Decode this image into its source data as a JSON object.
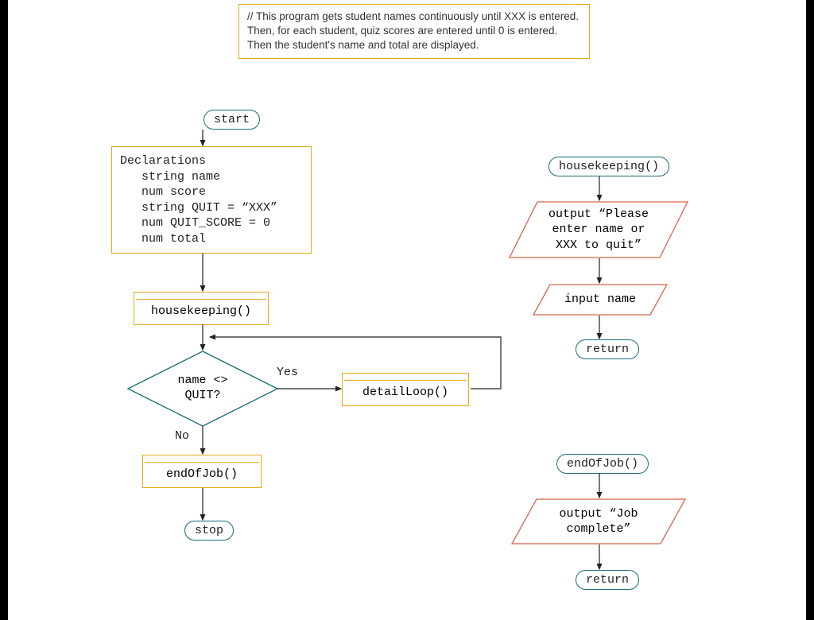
{
  "comment": "// This program gets student names continuously until XXX is entered. Then, for each student, quiz scores are entered until 0 is entered. Then the student's name and total are displayed.",
  "main": {
    "start": "start",
    "declarations": "Declarations\n   string name\n   num score\n   string QUIT = “XXX”\n   num QUIT_SCORE = 0\n   num total",
    "housekeeping_call": "housekeeping()",
    "decision": "name <>\nQUIT?",
    "yes": "Yes",
    "no": "No",
    "detailLoop_call": "detailLoop()",
    "endOfJob_call": "endOfJob()",
    "stop": "stop"
  },
  "housekeeping": {
    "header": "housekeeping()",
    "output": "output “Please\nenter name or\nXXX to quit”",
    "input": "input name",
    "return": "return"
  },
  "endOfJob": {
    "header": "endOfJob()",
    "output": "output “Job\ncomplete”",
    "return": "return"
  }
}
